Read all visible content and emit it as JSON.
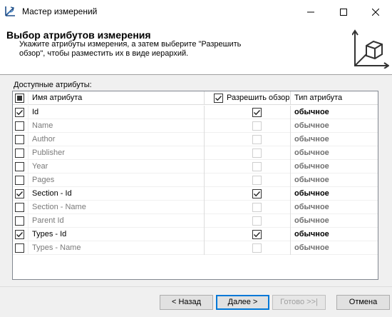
{
  "window": {
    "title": "Мастер измерений"
  },
  "header": {
    "title": "Выбор атрибутов измерения",
    "description": "Укажите атрибуты измерения, а затем выберите \"Разрешить обзор\", чтобы разместить их в виде иерархий."
  },
  "attributes_label": "Доступные атрибуты:",
  "grid": {
    "columns": {
      "name": "Имя атрибута",
      "browse": "Разрешить обзор",
      "type": "Тип атрибута"
    },
    "select_all_state": "indeterminate",
    "browse_all_checked": true,
    "rows": [
      {
        "name": "Id",
        "selected": true,
        "browse": true,
        "type": "обычное"
      },
      {
        "name": "Name",
        "selected": false,
        "browse": false,
        "type": "обычное"
      },
      {
        "name": "Author",
        "selected": false,
        "browse": false,
        "type": "обычное"
      },
      {
        "name": "Publisher",
        "selected": false,
        "browse": false,
        "type": "обычное"
      },
      {
        "name": "Year",
        "selected": false,
        "browse": false,
        "type": "обычное"
      },
      {
        "name": "Pages",
        "selected": false,
        "browse": false,
        "type": "обычное"
      },
      {
        "name": "Section - Id",
        "selected": true,
        "browse": true,
        "type": "обычное"
      },
      {
        "name": "Section - Name",
        "selected": false,
        "browse": false,
        "type": "обычное"
      },
      {
        "name": "Parent Id",
        "selected": false,
        "browse": false,
        "type": "обычное"
      },
      {
        "name": "Types - Id",
        "selected": true,
        "browse": true,
        "type": "обычное"
      },
      {
        "name": "Types - Name",
        "selected": false,
        "browse": false,
        "type": "обычное"
      }
    ]
  },
  "buttons": {
    "back": "< Назад",
    "next": "Далее >",
    "finish": "Готово >>|",
    "cancel": "Отмена"
  },
  "colors": {
    "accent": "#0078d7",
    "window_bg": "#f0f0f0",
    "header_bg": "#ffffff",
    "disabled_text": "#7a7a7a"
  },
  "icons": {
    "app": "dimension-wizard-icon",
    "header_graphic": "cube-axes-icon",
    "minimize": "minimize-icon",
    "maximize": "maximize-icon",
    "close": "close-icon"
  }
}
